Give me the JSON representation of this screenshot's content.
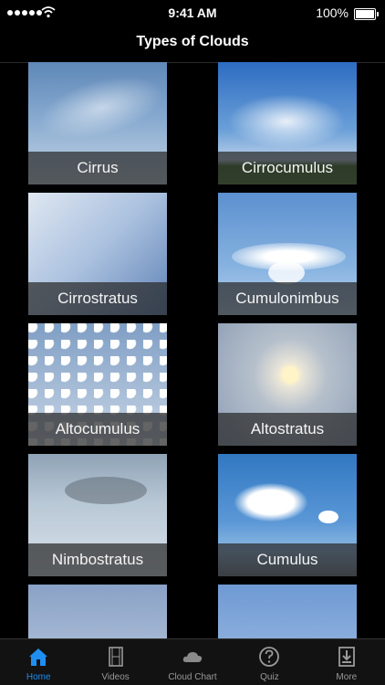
{
  "status_bar": {
    "time": "9:41 AM",
    "battery": "100%"
  },
  "nav": {
    "title": "Types of Clouds"
  },
  "clouds": [
    {
      "label": "Cirrus"
    },
    {
      "label": "Cirrocumulus"
    },
    {
      "label": "Cirrostratus"
    },
    {
      "label": "Cumulonimbus"
    },
    {
      "label": "Altocumulus"
    },
    {
      "label": "Altostratus"
    },
    {
      "label": "Nimbostratus"
    },
    {
      "label": "Cumulus"
    },
    {
      "label": ""
    },
    {
      "label": ""
    }
  ],
  "tabs": [
    {
      "label": "Home",
      "icon": "home-icon",
      "active": true
    },
    {
      "label": "Videos",
      "icon": "film-icon"
    },
    {
      "label": "Cloud Chart",
      "icon": "cloud-icon"
    },
    {
      "label": "Quiz",
      "icon": "question-icon"
    },
    {
      "label": "More",
      "icon": "download-icon"
    }
  ],
  "colors": {
    "accent": "#1f8ef1",
    "tab_inactive": "#9a9a9a",
    "background": "#000000"
  }
}
